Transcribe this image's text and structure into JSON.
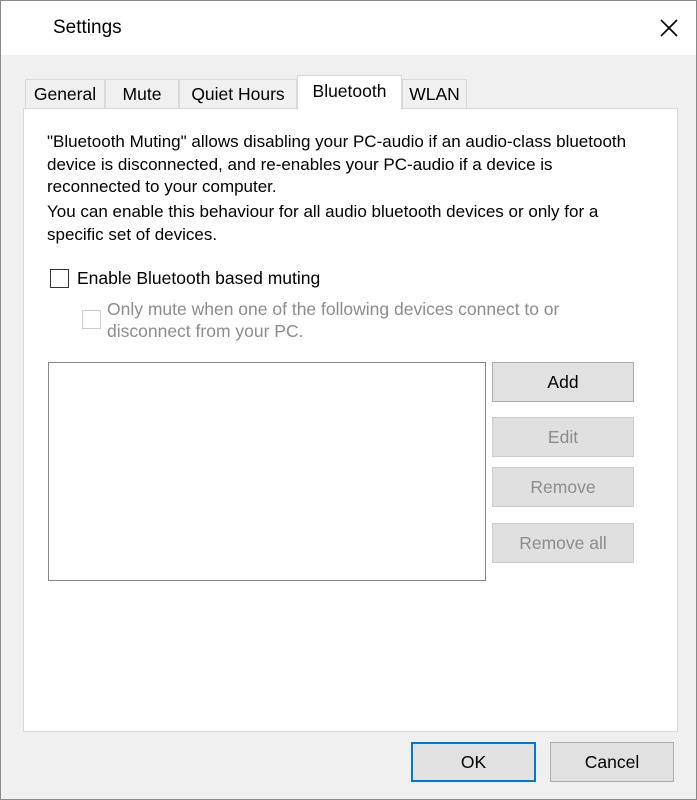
{
  "window": {
    "title": "Settings"
  },
  "tabs": [
    {
      "label": "General",
      "active": false
    },
    {
      "label": "Mute",
      "active": false
    },
    {
      "label": "Quiet Hours",
      "active": false
    },
    {
      "label": "Bluetooth",
      "active": true
    },
    {
      "label": "WLAN",
      "active": false
    }
  ],
  "bluetooth": {
    "description_1": "\"Bluetooth Muting\" allows disabling your PC-audio if an audio-class bluetooth device is disconnected, and re-enables your PC-audio if a device is reconnected to your computer.",
    "description_2": "You can enable this behaviour for all audio bluetooth devices or only for a specific set of devices.",
    "enable_checkbox": {
      "label": "Enable Bluetooth based muting",
      "checked": false,
      "enabled": true
    },
    "only_mute_checkbox": {
      "label": "Only mute when one of the following devices connect to or disconnect from your PC.",
      "checked": false,
      "enabled": false
    },
    "device_list": [],
    "buttons": {
      "add": "Add",
      "edit": "Edit",
      "remove": "Remove",
      "remove_all": "Remove all"
    }
  },
  "footer": {
    "ok": "OK",
    "cancel": "Cancel"
  },
  "colors": {
    "focus_border": "#0078d7",
    "disabled_text": "#8c8c8c",
    "dialog_bg": "#f0f0f0"
  }
}
